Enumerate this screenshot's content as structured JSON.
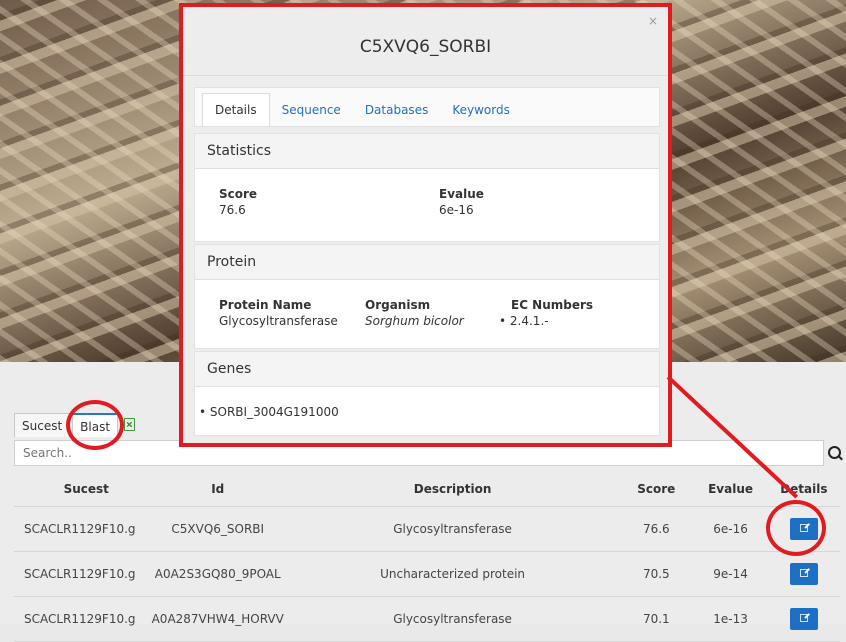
{
  "modal": {
    "title": "C5XVQ6_SORBI",
    "close": "×",
    "tabs": [
      "Details",
      "Sequence",
      "Databases",
      "Keywords"
    ],
    "statistics": {
      "title": "Statistics",
      "score_label": "Score",
      "score_value": "76.6",
      "evalue_label": "Evalue",
      "evalue_value": "6e-16"
    },
    "protein": {
      "title": "Protein",
      "name_label": "Protein Name",
      "name_value": "Glycosyltransferase",
      "organism_label": "Organism",
      "organism_value": "Sorghum bicolor",
      "ec_label": "EC Numbers",
      "ec_value": "2.4.1.-"
    },
    "genes": {
      "title": "Genes",
      "items": [
        "SORBI_3004G191000"
      ]
    }
  },
  "panel": {
    "tabs": [
      "Sucest",
      "Blast"
    ],
    "search_placeholder": "Search..",
    "columns": [
      "Sucest",
      "Id",
      "Description",
      "Score",
      "Evalue",
      "Details"
    ],
    "rows": [
      {
        "sucest": "SCACLR1129F10.g",
        "id": "C5XVQ6_SORBI",
        "description": "Glycosyltransferase",
        "score": "76.6",
        "evalue": "6e-16"
      },
      {
        "sucest": "SCACLR1129F10.g",
        "id": "A0A2S3GQ80_9POAL",
        "description": "Uncharacterized protein",
        "score": "70.5",
        "evalue": "9e-14"
      },
      {
        "sucest": "SCACLR1129F10.g",
        "id": "A0A287VHW4_HORVV",
        "description": "Glycosyltransferase",
        "score": "70.1",
        "evalue": "1e-13"
      }
    ]
  },
  "colors": {
    "highlight": "#e11b22",
    "accent": "#1d6fc4"
  }
}
